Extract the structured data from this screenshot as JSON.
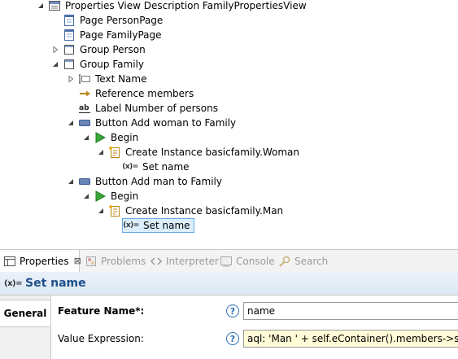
{
  "tree": {
    "items": [
      {
        "label": "Properties View Description FamilyPropertiesView",
        "icon": "view-description-icon"
      },
      {
        "label": "Page PersonPage",
        "icon": "page-icon"
      },
      {
        "label": "Page FamilyPage",
        "icon": "page-icon"
      },
      {
        "label": "Group Person",
        "icon": "group-icon"
      },
      {
        "label": "Group Family",
        "icon": "group-icon"
      },
      {
        "label": "Text Name",
        "icon": "text-widget-icon"
      },
      {
        "label": "Reference members",
        "icon": "reference-icon"
      },
      {
        "label": "Label Number of persons",
        "icon": "label-widget-icon"
      },
      {
        "label": "Button Add woman to Family",
        "icon": "button-widget-icon"
      },
      {
        "label": "Begin",
        "icon": "begin-icon"
      },
      {
        "label": "Create Instance basicfamily.Woman",
        "icon": "create-instance-icon"
      },
      {
        "label": "Set name",
        "icon": "set-variable-icon"
      },
      {
        "label": "Button Add man to Family",
        "icon": "button-widget-icon"
      },
      {
        "label": "Begin",
        "icon": "begin-icon"
      },
      {
        "label": "Create Instance basicfamily.Man",
        "icon": "create-instance-icon"
      },
      {
        "label": "Set name",
        "icon": "set-variable-icon",
        "selected": true
      }
    ],
    "var_glyph": "(x)="
  },
  "tabs": {
    "properties": "Properties",
    "problems": "Problems",
    "interpreter": "Interpreter",
    "console": "Console",
    "search": "Search",
    "close_glyph": "⊠"
  },
  "panel": {
    "title": "Set name",
    "title_glyph": "(x)=",
    "side_tab": "General",
    "help_glyph": "?",
    "feature_name_label": "Feature Name*:",
    "feature_name_value": "name",
    "value_expression_label": "Value Expression:",
    "value_expression_value": "aql: 'Man ' + self.eContainer().members->size()"
  },
  "colors": {
    "selection_fill": "#dbeefc",
    "selection_border": "#66a7e8",
    "title_text": "#1e4f8a",
    "expression_fill": "#fffbd6"
  }
}
